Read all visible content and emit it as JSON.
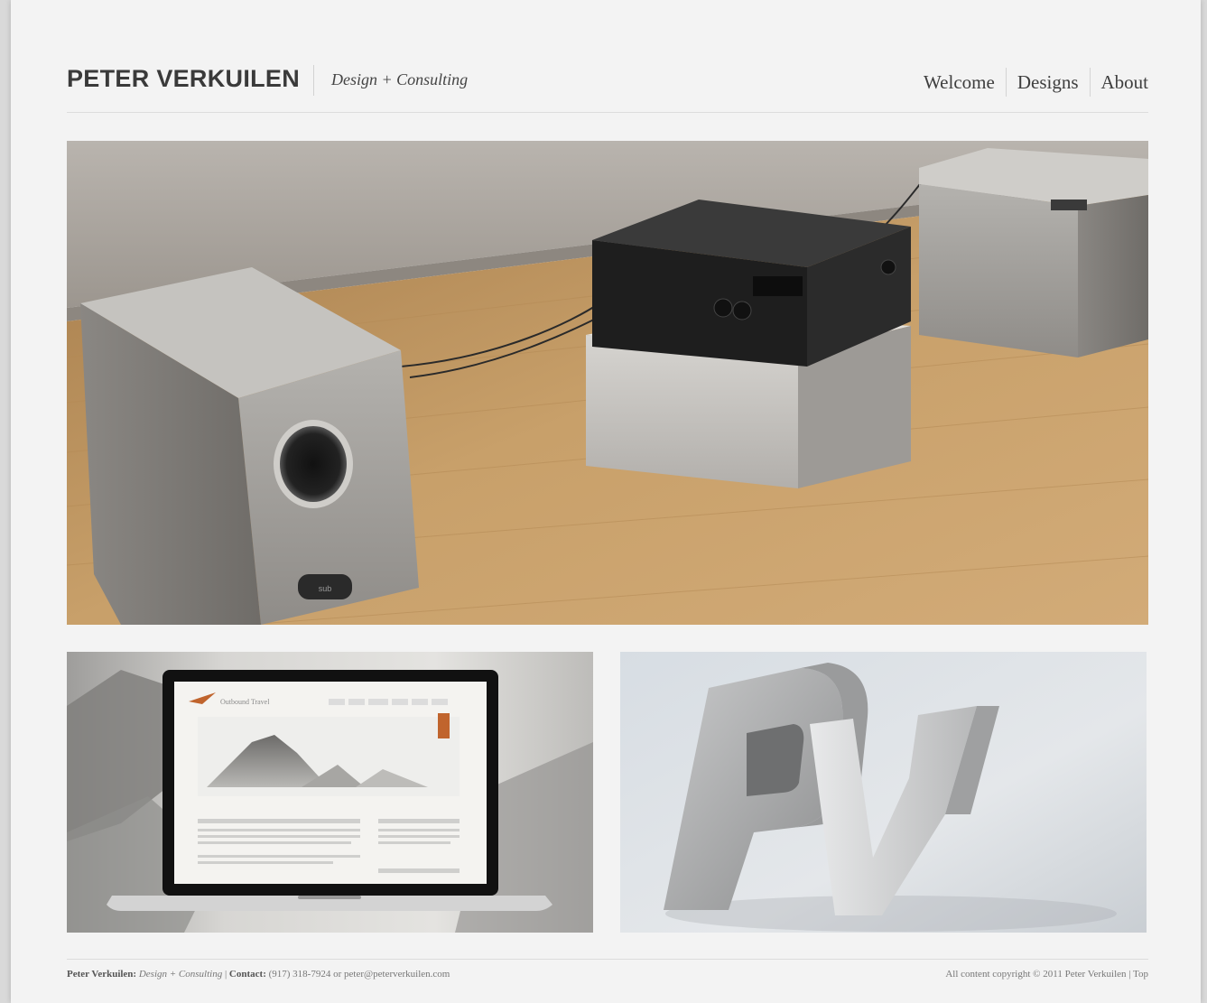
{
  "header": {
    "brand_name": "PETER VERKUILEN",
    "tagline": "Design + Consulting"
  },
  "nav": {
    "items": [
      {
        "label": "Welcome"
      },
      {
        "label": "Designs"
      },
      {
        "label": "About"
      }
    ]
  },
  "portfolio": {
    "hero": {
      "subject": "audio-system-render"
    },
    "thumb_left": {
      "subject": "laptop-website-mockup"
    },
    "thumb_right": {
      "subject": "pv-3d-logo"
    }
  },
  "footer": {
    "name": "Peter Verkuilen:",
    "tagline": "Design + Consulting",
    "separator": "|",
    "contact_label": "Contact:",
    "contact_text": "(917) 318-7924 or peter@peterverkuilen.com",
    "copyright": "All content copyright © 2011 Peter Verkuilen |",
    "top_link": "Top"
  },
  "colors": {
    "page_bg": "#f3f3f3",
    "outer_bg": "#d9d9d9",
    "text_dark": "#3a3a3a",
    "floor_wood": "#c49a62"
  }
}
